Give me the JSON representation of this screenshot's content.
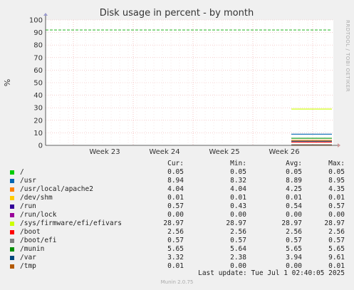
{
  "chart_data": {
    "type": "line",
    "title": "Disk usage in percent - by month",
    "ylabel": "%",
    "side_label": "RRDTOOL / TOBI OETIKER",
    "ylim": [
      0,
      100
    ],
    "yticks": [
      0,
      10,
      20,
      30,
      40,
      50,
      60,
      70,
      80,
      90,
      100
    ],
    "xticks": [
      "Week 23",
      "Week 24",
      "Week 25",
      "Week 26"
    ],
    "warning_line": 92,
    "legend_header": [
      "Cur:",
      "Min:",
      "Avg:",
      "Max:"
    ],
    "series": [
      {
        "name": "/",
        "color": "#00cc00",
        "cur": "0.05",
        "min": "0.05",
        "avg": "0.05",
        "max": "0.05"
      },
      {
        "name": "/usr",
        "color": "#0066b3",
        "cur": "8.94",
        "min": "8.32",
        "avg": "8.89",
        "max": "8.95"
      },
      {
        "name": "/usr/local/apache2",
        "color": "#ff8000",
        "cur": "4.04",
        "min": "4.04",
        "avg": "4.25",
        "max": "4.35"
      },
      {
        "name": "/dev/shm",
        "color": "#ffcc00",
        "cur": "0.01",
        "min": "0.01",
        "avg": "0.01",
        "max": "0.01"
      },
      {
        "name": "/run",
        "color": "#330099",
        "cur": "0.57",
        "min": "0.43",
        "avg": "0.54",
        "max": "0.57"
      },
      {
        "name": "/run/lock",
        "color": "#990099",
        "cur": "0.00",
        "min": "0.00",
        "avg": "0.00",
        "max": "0.00"
      },
      {
        "name": "/sys/firmware/efi/efivars",
        "color": "#ccff00",
        "cur": "28.97",
        "min": "28.97",
        "avg": "28.97",
        "max": "28.97"
      },
      {
        "name": "/boot",
        "color": "#ff0000",
        "cur": "2.56",
        "min": "2.56",
        "avg": "2.56",
        "max": "2.56"
      },
      {
        "name": "/boot/efi",
        "color": "#808080",
        "cur": "0.57",
        "min": "0.57",
        "avg": "0.57",
        "max": "0.57"
      },
      {
        "name": "/munin",
        "color": "#008f00",
        "cur": "5.65",
        "min": "5.64",
        "avg": "5.65",
        "max": "5.65"
      },
      {
        "name": "/var",
        "color": "#00487d",
        "cur": "3.32",
        "min": "2.38",
        "avg": "3.94",
        "max": "9.61"
      },
      {
        "name": "/tmp",
        "color": "#b35a00",
        "cur": "0.01",
        "min": "0.00",
        "avg": "0.00",
        "max": "0.01"
      }
    ]
  },
  "last_update": "Last update: Tue Jul  1 02:40:05 2025",
  "footer": "Munin 2.0.75"
}
